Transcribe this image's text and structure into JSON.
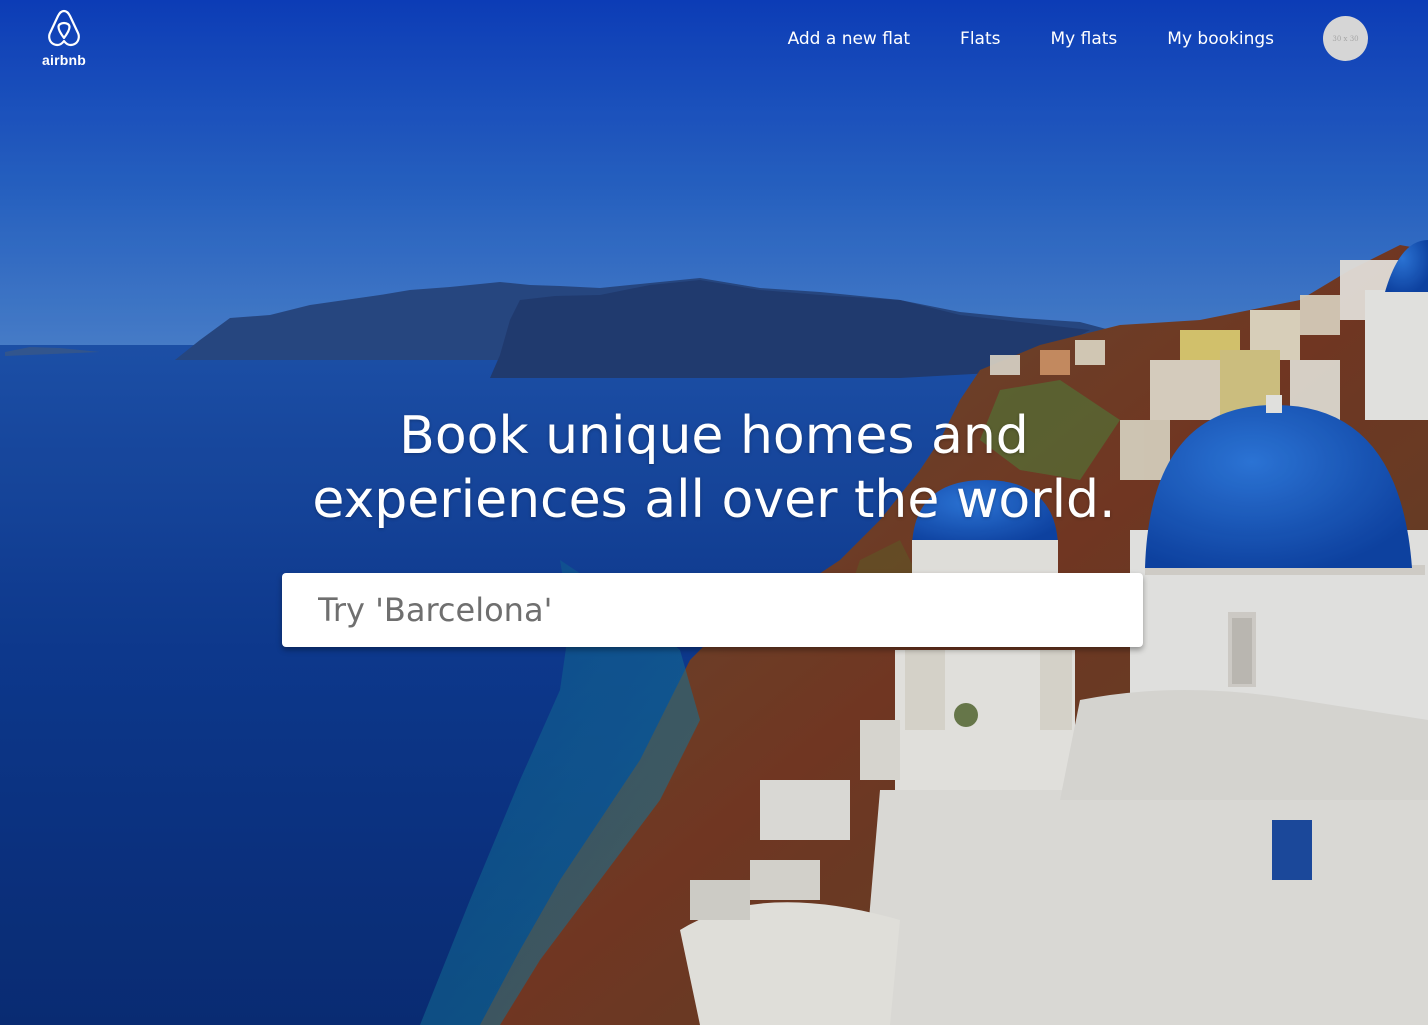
{
  "brand": {
    "name": "airbnb",
    "logo_icon": "airbnb-belo-icon"
  },
  "nav": {
    "items": [
      {
        "label": "Add a new flat"
      },
      {
        "label": "Flats"
      },
      {
        "label": "My flats"
      },
      {
        "label": "My bookings"
      }
    ],
    "avatar_text": "30 x 30"
  },
  "hero": {
    "headline_line1": "Book unique homes and",
    "headline_line2": "experiences all over the world.",
    "search_placeholder": "Try 'Barcelona'"
  },
  "colors": {
    "sky_top": "#1145c8",
    "sea": "#0c3a8f",
    "text": "#ffffff",
    "dome": "#1a5fd0"
  }
}
